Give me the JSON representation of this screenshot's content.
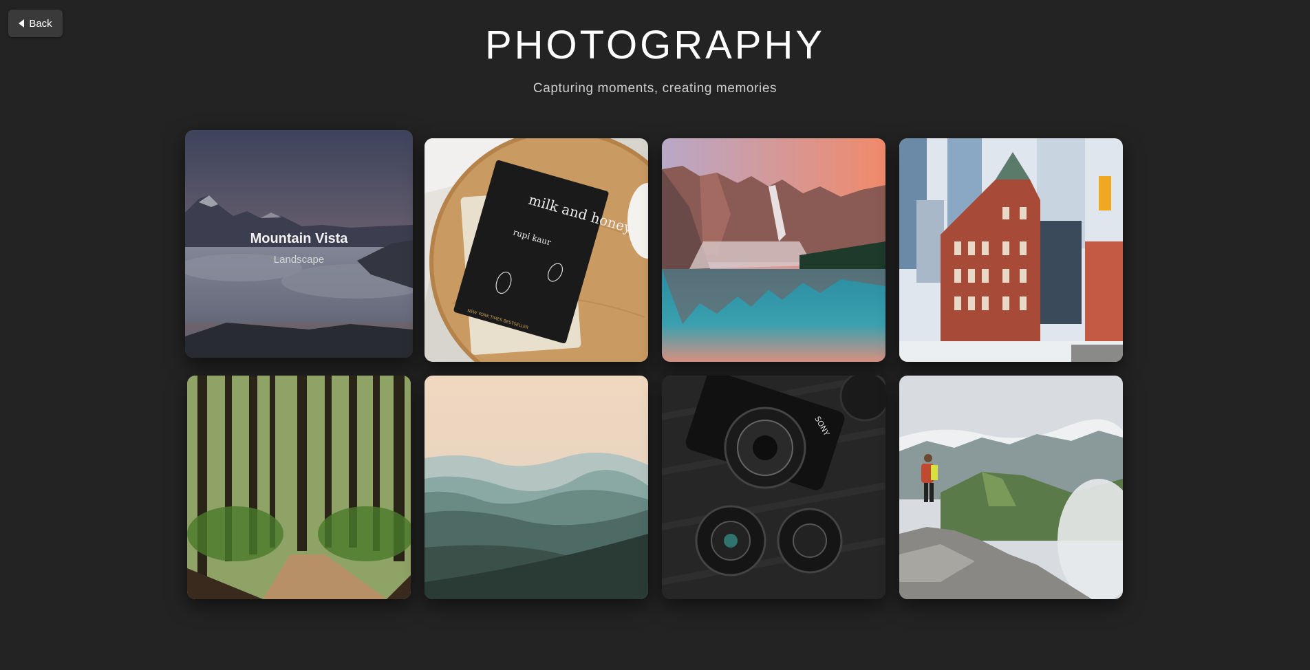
{
  "nav": {
    "back_label": "Back"
  },
  "header": {
    "title": "PHOTOGRAPHY",
    "subtitle": "Capturing moments, creating memories"
  },
  "gallery": {
    "items": [
      {
        "title": "Mountain Vista",
        "category": "Landscape",
        "icon": "mountain-sea-of-clouds"
      },
      {
        "book_title": "milk and honey",
        "book_author": "rupi kaur",
        "book_badge": "NEW YORK TIMES BESTSELLER",
        "icon": "book-on-table"
      },
      {
        "icon": "mountain-lake-reflection"
      },
      {
        "icon": "red-brick-building-city"
      },
      {
        "icon": "forest-path"
      },
      {
        "icon": "misty-mountain-ridges"
      },
      {
        "lens_text": "SONY",
        "icon": "camera-and-lenses"
      },
      {
        "icon": "hiker-on-cliff"
      }
    ]
  }
}
